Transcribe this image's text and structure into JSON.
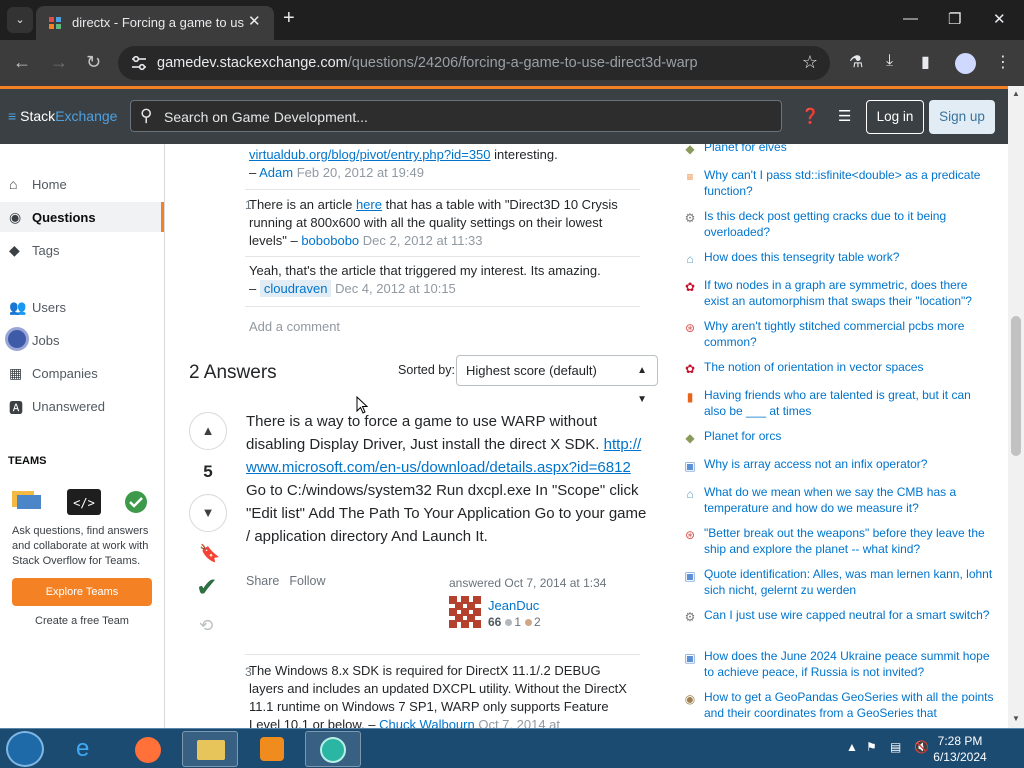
{
  "browser": {
    "tab_title": "directx - Forcing a game to use",
    "url_host": "gamedev.stackexchange.com",
    "url_path": "/questions/24206/forcing-a-game-to-use-direct3d-warp"
  },
  "site": {
    "logo_stack": "Stack",
    "logo_exchange": "Exchange",
    "search_placeholder": "Search on Game Development...",
    "login_label": "Log in",
    "signup_label": "Sign up"
  },
  "leftnav": {
    "items": [
      {
        "label": "Home",
        "icon": "home-icon"
      },
      {
        "label": "Questions",
        "icon": "questions-icon"
      },
      {
        "label": "Tags",
        "icon": "tag-icon"
      },
      {
        "label": "Users",
        "icon": "users-icon"
      },
      {
        "label": "Jobs",
        "icon": "jobs-icon"
      },
      {
        "label": "Companies",
        "icon": "companies-icon"
      },
      {
        "label": "Unanswered",
        "icon": "unanswered-icon"
      }
    ],
    "teams_heading": "TEAMS",
    "teams_text": "Ask questions, find answers and collaborate at work with Stack Overflow for Teams.",
    "explore_label": "Explore Teams",
    "create_label": "Create a free Team"
  },
  "comments": [
    {
      "score": "",
      "link": "virtualdub.org/blog/pivot/entry.php?id=350",
      "text_after": " interesting.",
      "user": "Adam",
      "date": "Feb 20, 2012 at 19:49"
    },
    {
      "score": "1",
      "text_before": "There is an article ",
      "link": "here",
      "text_after": " that has a table with \"Direct3D 10 Crysis running at 800x600 with all the quality settings on their lowest levels\" – ",
      "user": "bobobobo",
      "date": "Dec 2, 2012 at 11:33"
    },
    {
      "score": "",
      "text_before": "Yeah, that's the article that triggered my interest. Its amazing.",
      "user": "cloudraven",
      "date": "Dec 4, 2012 at 10:15"
    }
  ],
  "add_comment": "Add a comment",
  "answers_heading": "2 Answers",
  "sorted_by_label": "Sorted by:",
  "sort_value": "Highest score (default)",
  "answer": {
    "score": "5",
    "text_1": "There is a way to force a game to use WARP without disabling Display Driver, Just install the direct X SDK.",
    "link": "http://www.microsoft.com/en-us/download/details.aspx?id=6812",
    "text_2": " Go to C:/windows/system32 Run dxcpl.exe In \"Scope\" click \"Edit list\" Add The Path To Your Application Go to your game / application directory And Launch It.",
    "share": "Share",
    "follow": "Follow",
    "answered": "answered Oct 7, 2014 at 1:34",
    "user": "JeanDuc",
    "rep": "66",
    "silver": "1",
    "bronze": "2"
  },
  "answer_comment": {
    "score": "3",
    "text": "The Windows 8.x SDK is required for DirectX 11.1/.2 DEBUG layers and includes an updated DXCPL utility. Without the DirectX 11.1 runtime on Windows 7 SP1, WARP only supports Feature Level 10.1 or below. – ",
    "user": "Chuck Walbourn",
    "date": "Oct 7, 2014 at"
  },
  "hot_questions": [
    {
      "title": "Planet for elves",
      "icon_color": "#8a9a5b"
    },
    {
      "title": "Why can't I pass std::isfinite<double> as a predicate function?",
      "icon_color": "#e87922"
    },
    {
      "title": "Is this deck post getting cracks due to it being overloaded?",
      "icon_color": "#7a7a7a"
    },
    {
      "title": "How does this tensegrity table work?",
      "icon_color": "#5aa0c8"
    },
    {
      "title": "If two nodes in a graph are symmetric, does there exist an automorphism that swaps their \"location\"?",
      "icon_color": "#c8102e"
    },
    {
      "title": "Why aren't tightly stitched commercial pcbs more common?",
      "icon_color": "#d9534f"
    },
    {
      "title": "The notion of orientation in vector spaces",
      "icon_color": "#c8102e"
    },
    {
      "title": "Having friends who are talented is great, but it can also be ___ at times",
      "icon_color": "#e8641b"
    },
    {
      "title": "Planet for orcs",
      "icon_color": "#8a9a5b"
    },
    {
      "title": "Why is array access not an infix operator?",
      "icon_color": "#5b8fd6"
    },
    {
      "title": "What do we mean when we say the CMB has a temperature and how do we measure it?",
      "icon_color": "#5aa0c8"
    },
    {
      "title": "\"Better break out the weapons\" before they leave the ship and explore the planet -- what kind?",
      "icon_color": "#d9534f"
    },
    {
      "title": "Quote identification: Alles, was man lernen kann, lohnt sich nicht, gelernt zu werden",
      "icon_color": "#5b8fd6"
    },
    {
      "title": "Can I just use wire capped neutral for a smart switch?",
      "icon_color": "#7a7a7a"
    },
    {
      "title": "How does the June 2024 Ukraine peace summit hope to achieve peace, if Russia is not invited?",
      "icon_color": "#5b8fd6"
    },
    {
      "title": "How to get a GeoPandas GeoSeries with all the points and their coordinates from a GeoSeries that",
      "icon_color": "#a08050"
    }
  ],
  "taskbar": {
    "time": "7:28 PM",
    "date": "6/13/2024"
  }
}
